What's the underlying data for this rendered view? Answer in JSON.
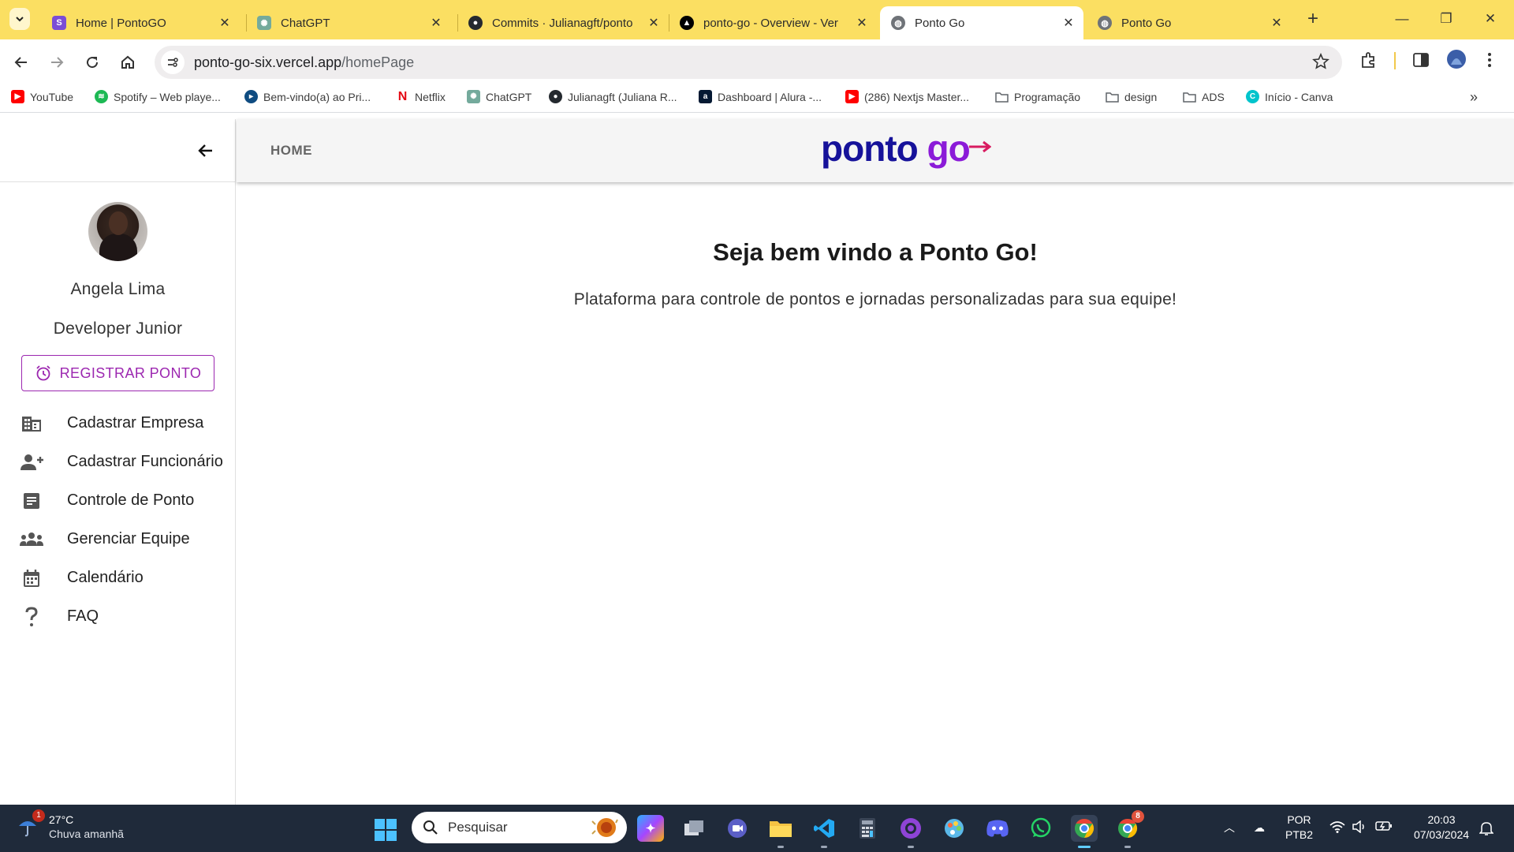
{
  "browser": {
    "tabs": [
      {
        "title": "Home | PontoGO",
        "icon": "pontogo-favicon"
      },
      {
        "title": "ChatGPT",
        "icon": "chatgpt-favicon"
      },
      {
        "title": "Commits · Julianagft/ponto",
        "icon": "github-favicon"
      },
      {
        "title": "ponto-go - Overview - Ver",
        "icon": "vercel-favicon"
      },
      {
        "title": "Ponto Go",
        "icon": "globe-favicon"
      },
      {
        "title": "Ponto Go",
        "icon": "globe-favicon"
      }
    ],
    "active_tab": 4,
    "url_host": "ponto-go-six.vercel.app",
    "url_path": "/homePage",
    "bookmarks": [
      {
        "label": "YouTube",
        "icon": "youtube-icon",
        "color": "#ff0000"
      },
      {
        "label": "Spotify – Web playe...",
        "icon": "spotify-icon",
        "color": "#1db954"
      },
      {
        "label": "Bem-vindo(a) ao Pri...",
        "icon": "prime-video-icon",
        "color": "#0f4c81"
      },
      {
        "label": "Netflix",
        "icon": "netflix-icon",
        "color": "#e50914"
      },
      {
        "label": "ChatGPT",
        "icon": "chatgpt-icon",
        "color": "#74aa9c"
      },
      {
        "label": "Julianagft (Juliana R...",
        "icon": "github-icon",
        "color": "#24292f"
      },
      {
        "label": "Dashboard | Alura -...",
        "icon": "alura-icon",
        "color": "#051933"
      },
      {
        "label": "(286) Nextjs Master...",
        "icon": "youtube-icon",
        "color": "#ff0000"
      },
      {
        "label": "Programação",
        "icon": "folder-icon",
        "color": "#5f6368"
      },
      {
        "label": "design",
        "icon": "folder-icon",
        "color": "#5f6368"
      },
      {
        "label": "ADS",
        "icon": "folder-icon",
        "color": "#5f6368"
      },
      {
        "label": "Início - Canva",
        "icon": "canva-icon",
        "color": "#00c4cc"
      }
    ]
  },
  "app": {
    "nav_home": "HOME",
    "logo_part1": "ponto",
    "logo_part2": "go",
    "user": {
      "name": "Angela Lima",
      "role": "Developer Junior"
    },
    "register_button": "REGISTRAR PONTO",
    "menu": [
      {
        "label": "Cadastrar Empresa",
        "icon": "business-icon"
      },
      {
        "label": "Cadastrar Funcionário",
        "icon": "person-add-icon"
      },
      {
        "label": "Controle de Ponto",
        "icon": "document-icon"
      },
      {
        "label": "Gerenciar Equipe",
        "icon": "groups-icon"
      },
      {
        "label": "Calendário",
        "icon": "calendar-icon"
      },
      {
        "label": "FAQ",
        "icon": "question-icon"
      }
    ],
    "welcome_title": "Seja bem vindo a Ponto Go!",
    "welcome_subtitle": "Plataforma para controle de pontos e jornadas personalizadas para sua equipe!"
  },
  "taskbar": {
    "weather_temp": "27°C",
    "weather_condition": "Chuva amanhã",
    "weather_badge": "1",
    "search_placeholder": "Pesquisar",
    "chrome_badge": "8",
    "language_line1": "POR",
    "language_line2": "PTB2",
    "time": "20:03",
    "date": "07/03/2024"
  },
  "colors": {
    "accent_purple": "#9c27b0",
    "logo_navy": "#16129a",
    "logo_purple": "#8b1bd8",
    "tab_strip": "#fbdf62"
  }
}
